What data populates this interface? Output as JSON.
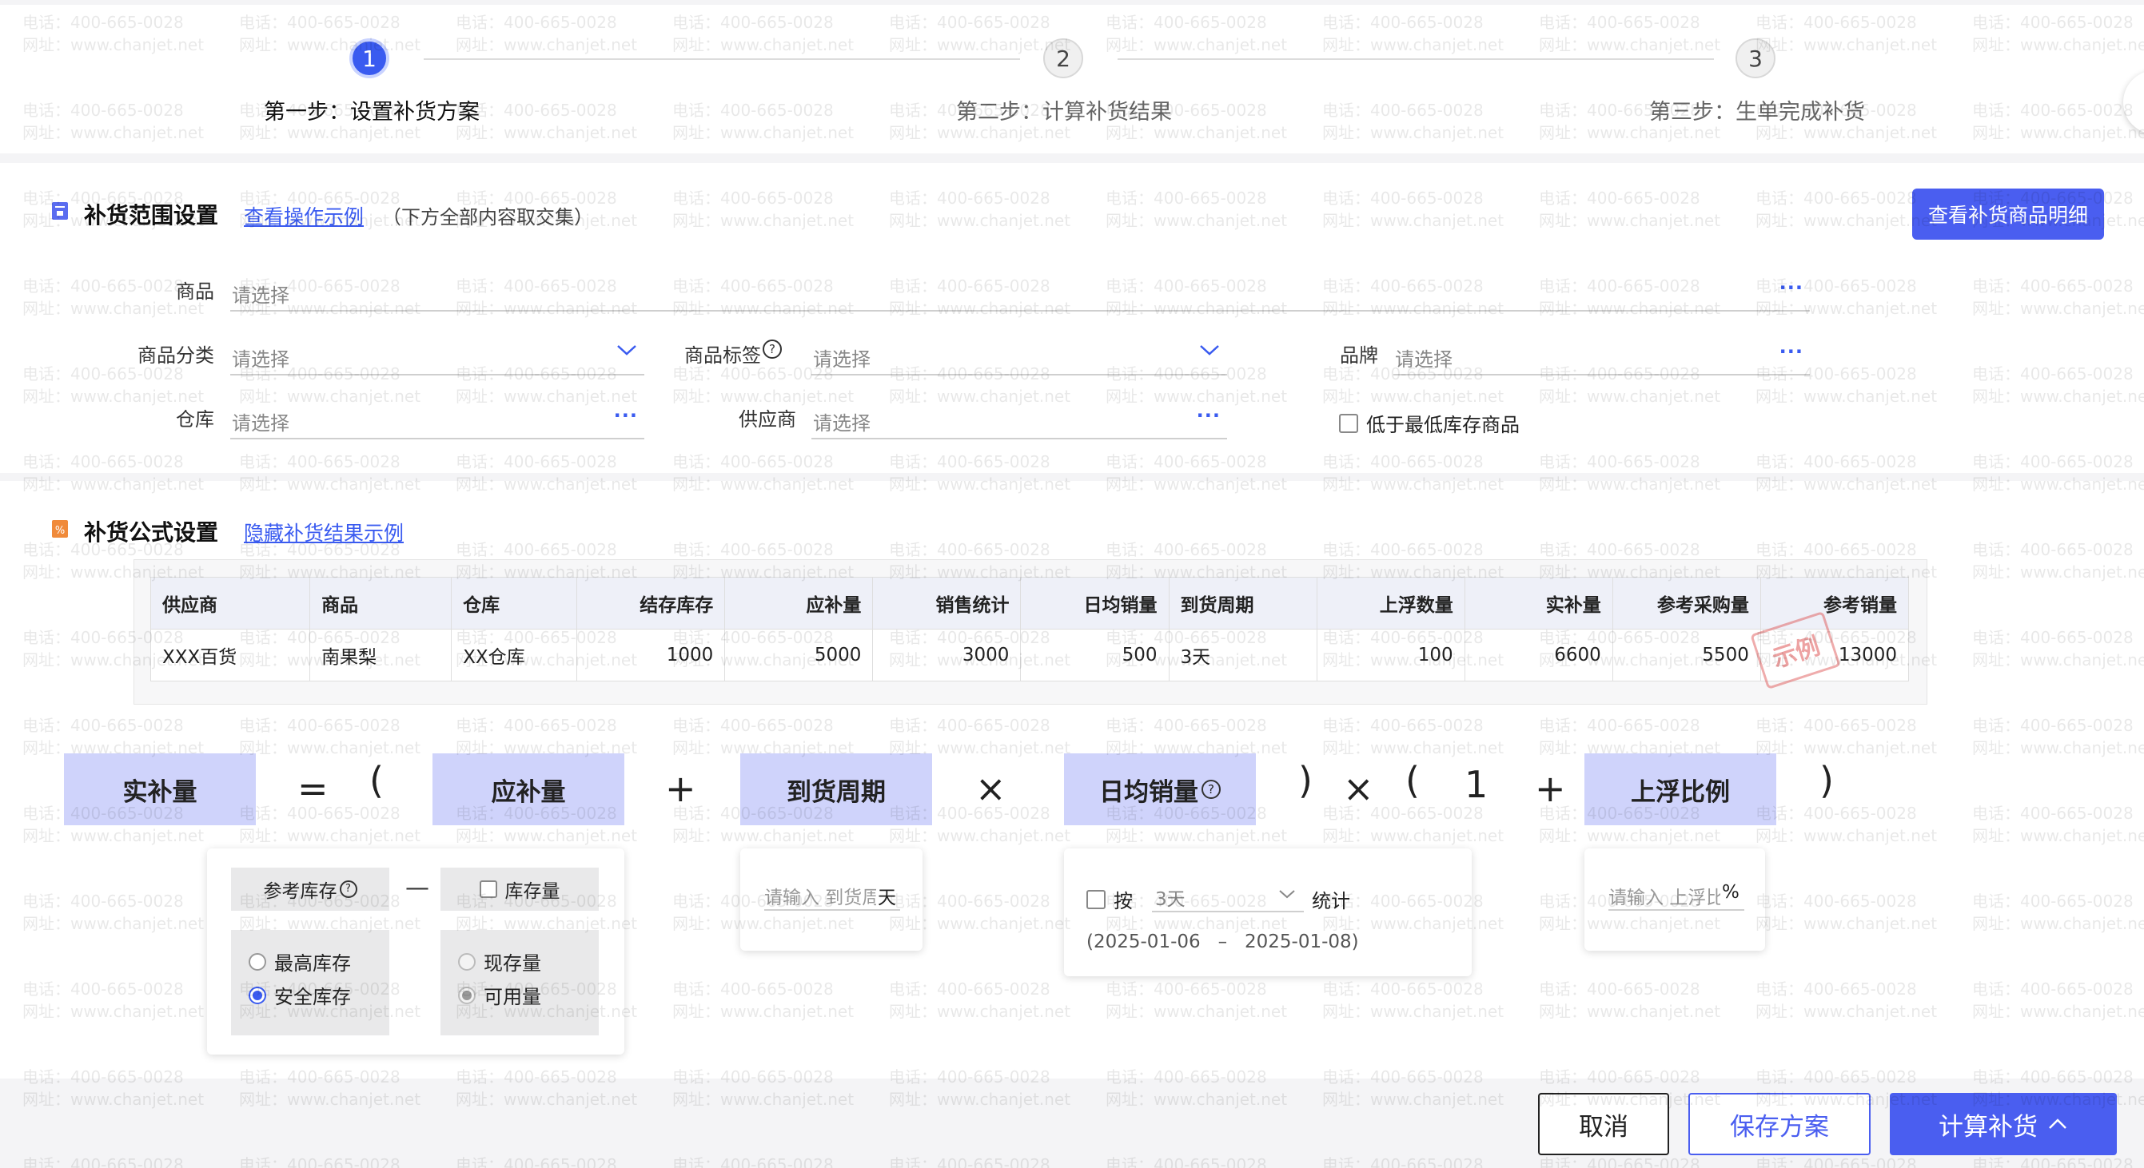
{
  "steps": [
    {
      "num": "1",
      "label": "第一步：设置补货方案"
    },
    {
      "num": "2",
      "label": "第二步：计算补货结果"
    },
    {
      "num": "3",
      "label": "第三步：生单完成补货"
    }
  ],
  "range_section": {
    "title": "补货范围设置",
    "example_link": "查看操作示例",
    "hint": "（下方全部内容取交集）",
    "detail_button": "查看补货商品明细",
    "placeholder": "请选择",
    "fields": {
      "goods": "商品",
      "category": "商品分类",
      "tag": "商品标签",
      "brand": "品牌",
      "warehouse": "仓库",
      "supplier": "供应商"
    },
    "low_stock_checkbox": "低于最低库存商品"
  },
  "formula_section": {
    "title": "补货公式设置",
    "hide_link": "隐藏补货结果示例"
  },
  "example_table": {
    "headers": [
      "供应商",
      "商品",
      "仓库",
      "结存库存",
      "应补量",
      "销售统计",
      "日均销量",
      "到货周期",
      "上浮数量",
      "实补量",
      "参考采购量",
      "参考销量"
    ],
    "row": [
      "XXX百货",
      "南果梨",
      "XX仓库",
      "1000",
      "5000",
      "3000",
      "500",
      "3天",
      "100",
      "6600",
      "5500",
      "13000"
    ],
    "stamp": "示例"
  },
  "formula": {
    "actual": "实补量",
    "should": "应补量",
    "period": "到货周期",
    "daily": "日均销量",
    "float": "上浮比例",
    "eq": "=",
    "lparen": "(",
    "rparen": ")",
    "plus": "+",
    "times": "×",
    "one": "1",
    "minus": "—"
  },
  "should_card": {
    "ref_stock": "参考库存",
    "stock_qty": "库存量",
    "max_stock": "最高库存",
    "safe_stock": "安全库存",
    "current_stock": "现存量",
    "available": "可用量"
  },
  "period_card": {
    "placeholder": "请输入 到货周期",
    "unit": "天"
  },
  "daily_card": {
    "by": "按",
    "days": "3天",
    "stat": "统计",
    "date_range": "(2025-01-06   –   2025-01-08)"
  },
  "float_card": {
    "placeholder": "请输入 上浮比例",
    "unit": "%"
  },
  "footer": {
    "cancel": "取消",
    "save": "保存方案",
    "calc": "计算补货"
  },
  "watermark": {
    "phone": "电话：400-665-0028",
    "site": "网址：www.chanjet.net"
  },
  "colors": {
    "primary": "#4a5ef0",
    "formula_box": "#cfd3fb"
  }
}
